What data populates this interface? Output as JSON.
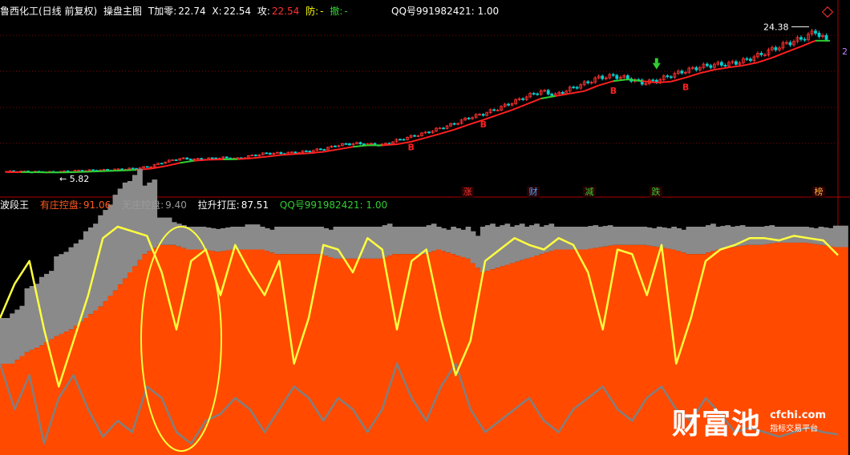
{
  "main_header": {
    "name": "鲁西化工(日线 前复权)",
    "indicator": "操盘主图",
    "t_label": "T加零:",
    "t_value": "22.74",
    "x_label": "X:",
    "x_value": "22.54",
    "attack_label": "攻:",
    "attack_value": "22.54",
    "defend_label": "防:",
    "defend_value": "-",
    "withdraw_label": "撤:",
    "withdraw_value": "-",
    "qq_text": "QQ号991982421: 1.00"
  },
  "sub_header": {
    "name": "波段王",
    "zhuang_label": "有庄控盘:",
    "zhuang_value": "91.06",
    "no_zhuang_label": "无庄控盘:",
    "no_zhuang_value": "9.40",
    "pull_label": "拉升打压:",
    "pull_value": "87.51",
    "qq_text": "QQ号991982421: 1.00"
  },
  "price_labels": {
    "high": "24.38",
    "low": "5.82",
    "right_edge_mark": "2"
  },
  "signal_tags": [
    {
      "text": "涨",
      "color": "#ff3030"
    },
    {
      "text": "财",
      "color": "#4aa3ff"
    },
    {
      "text": "减",
      "color": "#32cd32"
    },
    {
      "text": "跌",
      "color": "#32cd32"
    },
    {
      "text": "榜",
      "color": "#ffb040"
    }
  ],
  "buy_marker_text": "B",
  "watermark": {
    "brand": "财富池",
    "url": "cfchi.com",
    "subtitle": "指标交易平台"
  },
  "colors": {
    "background": "#000000",
    "up_candle": "#ff3030",
    "down_candle": "#00d0d0",
    "ma_red": "#ff2020",
    "ma_green": "#32cd32",
    "area_orange": "#ff4a00",
    "area_gray": "#8a8a8a",
    "line_yellow": "#ffff40",
    "line_gray": "#808080",
    "grid": "#8b0000"
  },
  "chart_data": [
    {
      "type": "candlestick",
      "description_free": true,
      "price_close": [
        5.9,
        5.9,
        5.85,
        5.82,
        5.9,
        6.0,
        6.05,
        6.1,
        6.2,
        6.3,
        6.6,
        7.2,
        7.6,
        7.5,
        7.6,
        7.7,
        7.6,
        8.0,
        8.3,
        8.3,
        8.4,
        8.6,
        8.9,
        9.4,
        9.6,
        9.5,
        9.4,
        10.0,
        10.5,
        11.0,
        11.6,
        12.2,
        13.0,
        13.5,
        14.2,
        15.0,
        15.8,
        16.5,
        16.0,
        16.8,
        17.5,
        18.3,
        18.5,
        18.2,
        17.6,
        17.9,
        18.6,
        19.2,
        19.7,
        20.0,
        20.1,
        20.5,
        21.2,
        22.0,
        22.8,
        23.4,
        24.38,
        22.74
      ],
      "ylim": [
        4.0,
        26.0
      ],
      "max_label": 24.38,
      "min_label": 5.82
    },
    {
      "type": "area",
      "series": [
        {
          "name": "有庄控盘",
          "values": [
            40,
            40,
            45,
            48,
            52,
            55,
            60,
            65,
            72,
            80,
            88,
            92,
            92,
            90,
            90,
            89,
            90,
            90,
            90,
            88,
            88,
            88,
            88,
            86,
            86,
            86,
            86,
            88,
            88,
            88,
            90,
            88,
            86,
            80,
            82,
            84,
            86,
            88,
            90,
            90,
            90,
            91,
            92,
            92,
            92,
            91,
            90,
            88,
            88,
            90,
            91,
            92,
            92,
            93,
            93,
            93,
            92,
            91.06
          ]
        },
        {
          "name": "无庄控盘",
          "values": [
            20,
            22,
            28,
            30,
            35,
            36,
            38,
            40,
            42,
            40,
            30,
            12,
            10,
            10,
            10,
            10,
            10,
            11,
            10,
            12,
            12,
            12,
            12,
            14,
            14,
            14,
            14,
            12,
            12,
            12,
            10,
            12,
            14,
            20,
            18,
            16,
            14,
            12,
            10,
            10,
            10,
            9,
            8,
            8,
            8,
            9,
            10,
            12,
            12,
            10,
            9,
            8,
            8,
            7,
            7,
            7,
            8,
            9.4
          ]
        },
        {
          "name": "拉升打压",
          "values": [
            60,
            75,
            85,
            55,
            30,
            50,
            70,
            95,
            100,
            98,
            96,
            80,
            55,
            85,
            90,
            70,
            92,
            80,
            70,
            85,
            40,
            60,
            92,
            90,
            80,
            95,
            90,
            55,
            85,
            90,
            60,
            35,
            50,
            85,
            90,
            95,
            92,
            90,
            95,
            92,
            80,
            55,
            90,
            88,
            70,
            92,
            40,
            60,
            85,
            90,
            92,
            95,
            95,
            94,
            96,
            95,
            94,
            87.51
          ]
        },
        {
          "name": "gray_line",
          "values": [
            40,
            20,
            35,
            5,
            25,
            35,
            20,
            8,
            15,
            10,
            30,
            25,
            10,
            5,
            15,
            18,
            25,
            20,
            10,
            20,
            30,
            25,
            15,
            25,
            20,
            10,
            20,
            40,
            25,
            15,
            30,
            40,
            20,
            10,
            15,
            20,
            25,
            15,
            10,
            20,
            25,
            30,
            20,
            15,
            25,
            30,
            20,
            15,
            25,
            18,
            10,
            12,
            10,
            8,
            10,
            12,
            10,
            9
          ]
        }
      ],
      "ylim": [
        0,
        100
      ]
    }
  ]
}
